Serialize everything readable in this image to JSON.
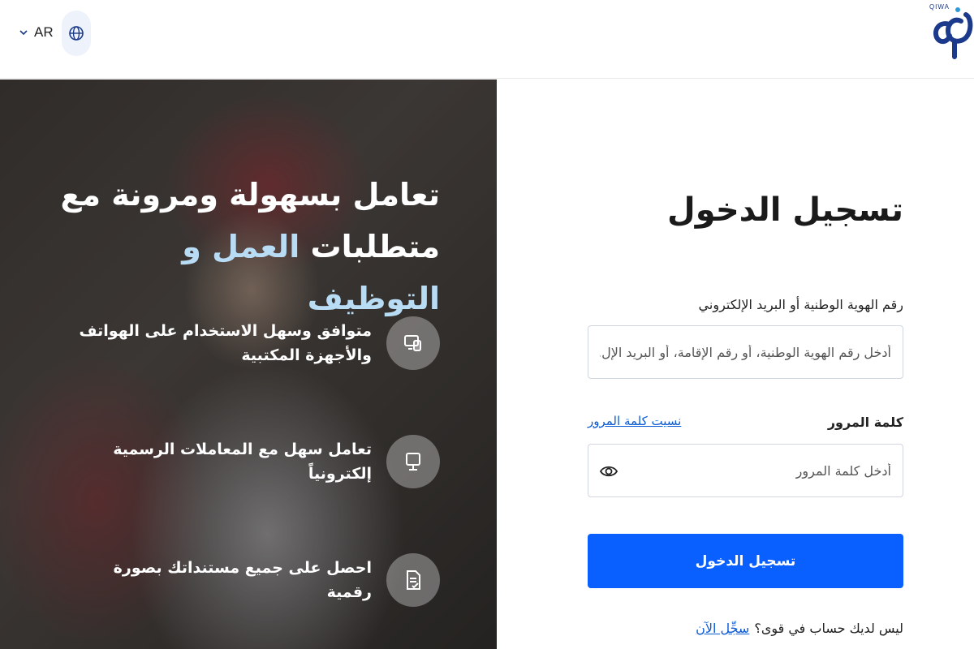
{
  "header": {
    "language_code": "AR",
    "logo_text": "QIWA"
  },
  "hero": {
    "headline_line1": "تعامل بسهولة ومرونة مع",
    "headline_line2_prefix": "متطلبات ",
    "headline_line2_accent": "العمل و التوظيف",
    "features": [
      {
        "text": "متوافق وسهل الاستخدام على الهواتف والأجهزة المكتبية",
        "icon": "devices-icon"
      },
      {
        "text": "تعامل سهل مع المعاملات الرسمية إلكترونياً",
        "icon": "monitor-icon"
      },
      {
        "text": "احصل على جميع مستنداتك بصورة رقمية",
        "icon": "document-icon"
      }
    ]
  },
  "form": {
    "title": "تسجيل الدخول",
    "id_label": "رقم الهوية الوطنية أو البريد الإلكتروني",
    "id_placeholder": "أدخل رقم الهوية الوطنية، أو رقم الإقامة، أو البريد الإل...",
    "password_label": "كلمة المرور",
    "forgot_password": "نسيت كلمة المرور",
    "password_placeholder": "أدخل كلمة المرور",
    "submit_label": "تسجيل الدخول",
    "no_account_text": "ليس لديك حساب في قوى؟",
    "register_link": "سجِّل الآن"
  },
  "colors": {
    "primary": "#0a60ff",
    "link": "#0b5bd3",
    "accent_text": "#b9dcf5"
  }
}
